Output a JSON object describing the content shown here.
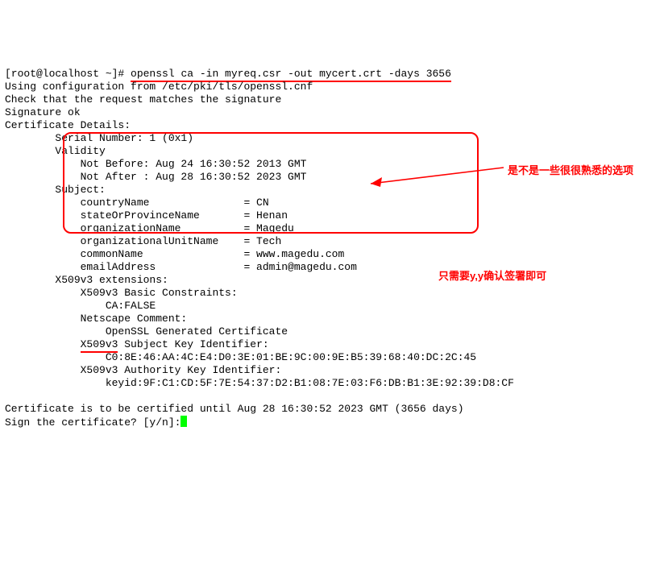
{
  "prompt": {
    "left": "[root@localhost ~]# ",
    "cmd": "openssl ca -in myreq.csr -out mycert.crt -days 3656"
  },
  "lines": {
    "using_cfg": "Using configuration from /etc/pki/tls/openssl.cnf",
    "check": "Check that the request matches the signature",
    "sig_ok": "Signature ok",
    "cert_details": "Certificate Details:",
    "serial": "        Serial Number: 1 (0x1)",
    "validity": "        Validity",
    "not_before": "            Not Before: Aug 24 16:30:52 2013 GMT",
    "not_after": "            Not After : Aug 28 16:30:52 2023 GMT",
    "subject": "        Subject:",
    "country": "            countryName               = CN",
    "state": "            stateOrProvinceName       = Henan",
    "org": "            organizationName          = Magedu",
    "orgunit": "            organizationalUnitName    = Tech",
    "common": "            commonName                = www.magedu.com",
    "email": "            emailAddress              = admin@magedu.com",
    "x509ext": "        X509v3 extensions:",
    "basic": "            X509v3 Basic Constraints:",
    "cafalse": "                CA:FALSE",
    "netscape": "            Netscape Comment:",
    "gen": "                OpenSSL Generated Certificate",
    "ski_prefix": "            ",
    "ski_mid": "X509v3",
    "ski_suffix": " Subject Key Identifier:",
    "ski_val": "                C0:8E:46:AA:4C:E4:D0:3E:01:BE:9C:00:9E:B5:39:68:40:DC:2C:45",
    "aki": "            X509v3 Authority Key Identifier:",
    "aki_val": "                keyid:9F:C1:CD:5F:7E:54:37:D2:B1:08:7E:03:F6:DB:B1:3E:92:39:D8:CF",
    "blank": "",
    "certified": "Certificate is to be certified until Aug 28 16:30:52 2023 GMT (3656 days)",
    "sign": "Sign the certificate? [y/n]:"
  },
  "annotations": {
    "familiar": "是不是一些很很熟悉的选项",
    "confirm": "只需要y,y确认签署即可"
  }
}
